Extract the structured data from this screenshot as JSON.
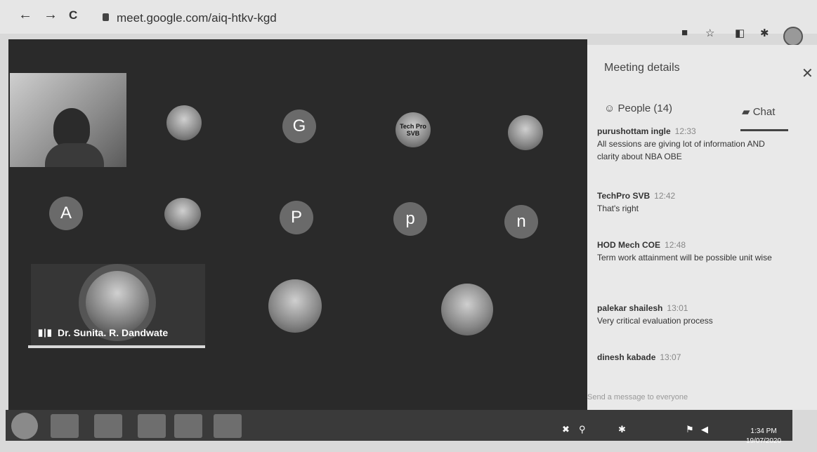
{
  "browser": {
    "back": "←",
    "forward": "→",
    "reload": "C",
    "url": "meet.google.com/aiq-htkv-kgd"
  },
  "tiles": {
    "g": "G",
    "a": "A",
    "p_upper": "P",
    "p_lower": "p",
    "n": "n",
    "techpro_logo_text": "Tech Pro SVB"
  },
  "speaker": {
    "name": "Dr. Sunita. R. Dandwate"
  },
  "panel": {
    "title": "Meeting details",
    "people_tab": "People (14)",
    "chat_tab": "Chat",
    "compose_placeholder": "Send a message to everyone"
  },
  "messages": [
    {
      "sender": "purushottam ingle",
      "time": "12:33",
      "text": "All sessions are giving lot of information AND clarity about NBA OBE"
    },
    {
      "sender": "TechPro SVB",
      "time": "12:42",
      "text": "That's right"
    },
    {
      "sender": "HOD Mech COE",
      "time": "12:48",
      "text": "Term work attainment will be possible unit wise"
    },
    {
      "sender": "palekar shailesh",
      "time": "13:01",
      "text": "Very critical evaluation process"
    },
    {
      "sender": "dinesh kabade",
      "time": "13:07",
      "text": ""
    }
  ],
  "taskbar": {
    "time": "1:34 PM",
    "date": "19/07/2020"
  },
  "icons": [
    "back-icon",
    "forward-icon",
    "reload-icon",
    "lock-icon",
    "camera-icon",
    "star-icon",
    "extension-icon",
    "puzzle-icon",
    "profile-icon",
    "people-icon",
    "chat-icon",
    "close-icon",
    "mic-bars-icon"
  ]
}
